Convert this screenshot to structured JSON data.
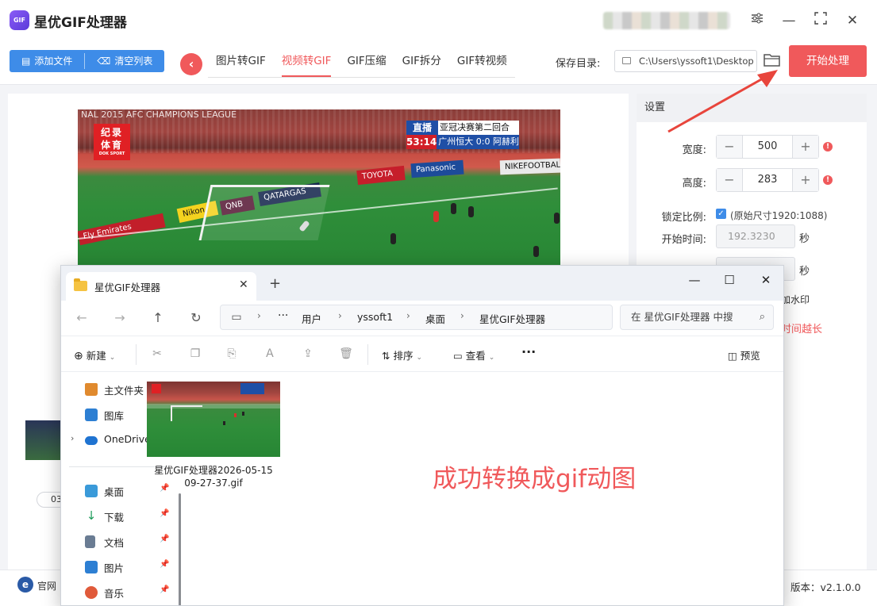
{
  "app": {
    "title": "星优GIF处理器",
    "logo_text": "GIF",
    "accent_color": "#f0595b",
    "primary_color": "#3e8ce8"
  },
  "toolbar": {
    "add_file": "添加文件",
    "clear_list": "清空列表",
    "tabs": [
      "图片转GIF",
      "视频转GIF",
      "GIF压缩",
      "GIF拆分",
      "GIF转视频"
    ],
    "active_tab": "视频转GIF",
    "save_dir_label": "保存目录:",
    "save_dir_value": "C:\\Users\\yssoft1\\Desktop",
    "start_button": "开始处理"
  },
  "preview": {
    "league_text": "NAL 2015    AFC CHAMPIONS LEAGUE",
    "logo_text": "纪录体育",
    "logo_sub": "DOK SPORT",
    "live_label": "直播",
    "match_title": "亚冠决赛第二回合",
    "match_time": "53:14",
    "match_score": "广州恒大 0:0 阿赫利",
    "ads": [
      "Fly Emirates",
      "Nikon",
      "QNB",
      "QATARGAS",
      "TOYOTA",
      "Panasonic",
      "NIKEFOOTBALL"
    ]
  },
  "settings": {
    "header": "设置",
    "width_label": "宽度:",
    "width_value": "500",
    "height_label": "高度:",
    "height_value": "283",
    "lock_label": "锁定比例:",
    "lock_text": "(原始尺寸1920:1088)",
    "start_time_label": "开始时间:",
    "start_time_value": "192.3230",
    "unit": "秒",
    "watermark_tail": "加水印",
    "warning_tail": "时间越长"
  },
  "left_list": {
    "pill_text": "03"
  },
  "bottom": {
    "web_label": "官网",
    "version": "版本：v2.1.0.0"
  },
  "explorer": {
    "tab_title": "星优GIF处理器",
    "breadcrumbs": [
      "用户",
      "yssoft1",
      "桌面",
      "星优GIF处理器"
    ],
    "search_placeholder": "在 星优GIF处理器 中搜",
    "cmd_new": "新建",
    "cmd_sort": "排序",
    "cmd_view": "查看",
    "cmd_preview": "预览",
    "sidebar": [
      {
        "label": "主文件夹",
        "icon": "home-icon",
        "color": "#e08a2e"
      },
      {
        "label": "图库",
        "icon": "gallery-icon",
        "color": "#2d7fd3"
      },
      {
        "label": "OneDrive",
        "icon": "cloud-icon",
        "color": "#1f73d1"
      },
      {
        "label": "桌面",
        "icon": "desktop-icon",
        "color": "#3a9ad9"
      },
      {
        "label": "下载",
        "icon": "download-icon",
        "color": "#1c9a59"
      },
      {
        "label": "文档",
        "icon": "document-icon",
        "color": "#6a7c93"
      },
      {
        "label": "图片",
        "icon": "pictures-icon",
        "color": "#2d7fd3"
      },
      {
        "label": "音乐",
        "icon": "music-icon",
        "color": "#e05a3a"
      }
    ],
    "file_name_line1": "星优GIF处理器2026-05-15",
    "file_name_line2": "09-27-37.gif"
  },
  "annotation": {
    "success_text": "成功转换成gif动图"
  }
}
